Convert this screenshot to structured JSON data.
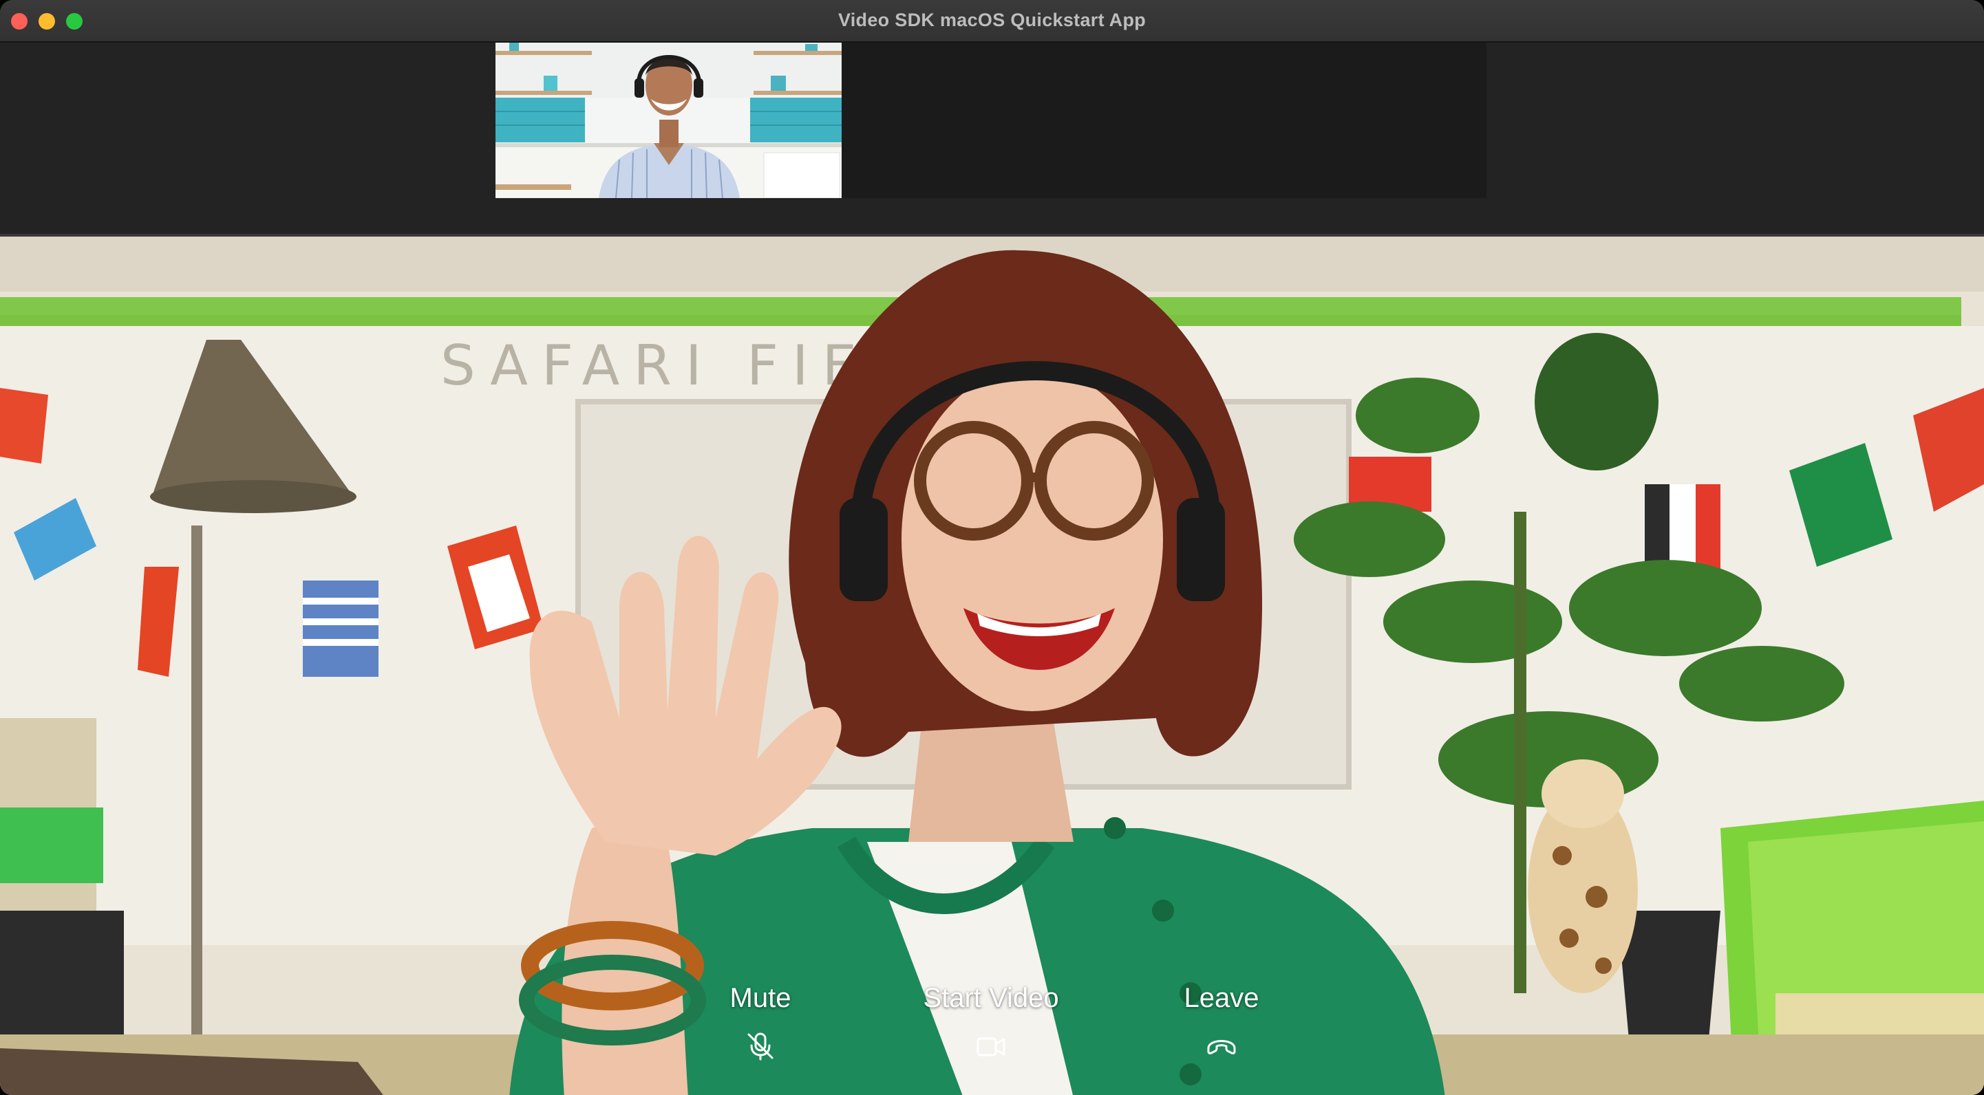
{
  "window": {
    "title": "Video SDK macOS Quickstart App"
  },
  "controls": {
    "mute": {
      "label": "Mute",
      "icon": "mic-off-icon"
    },
    "start_video": {
      "label": "Start Video",
      "icon": "video-camera-icon"
    },
    "leave": {
      "label": "Leave",
      "icon": "phone-hangup-icon"
    }
  },
  "colors": {
    "titlebar": "#323232",
    "strip": "#232323",
    "close": "#fe5f57",
    "minimize": "#febc2e",
    "zoom": "#28c840"
  }
}
